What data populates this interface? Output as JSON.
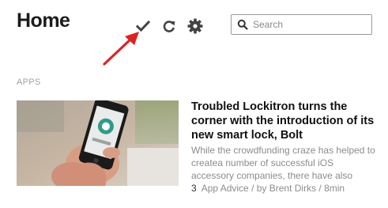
{
  "header": {
    "title": "Home",
    "toolbar": {
      "mark_read_icon": "checkmark-icon",
      "refresh_icon": "refresh-icon",
      "settings_icon": "gear-icon"
    },
    "search": {
      "placeholder": "Search",
      "value": ""
    },
    "annotation_color": "#e02020"
  },
  "section": {
    "label": "APPS"
  },
  "article": {
    "headline": "Troubled Lockitron turns the corner with the introduction of its new smart lock, Bolt",
    "snippet": "While the crowdfunding craze has helped to createa number of successful iOS accessory companies, there have also",
    "count": "3",
    "byline": "App Advice / by Brent Dirks / 8min"
  }
}
